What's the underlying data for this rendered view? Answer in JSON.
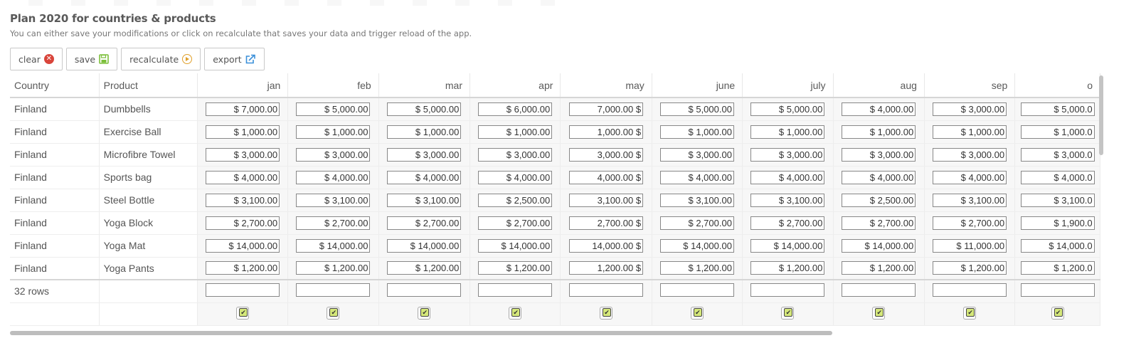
{
  "header": {
    "title": "Plan 2020 for countries & products",
    "subtitle": "You can either save your modifications or click on recalculate that saves your data and trigger reload of the app."
  },
  "toolbar": {
    "clear_label": "clear",
    "save_label": "save",
    "recalculate_label": "recalculate",
    "export_label": "export"
  },
  "table": {
    "columns": [
      "Country",
      "Product",
      "jan",
      "feb",
      "mar",
      "apr",
      "may",
      "june",
      "july",
      "aug",
      "sep",
      "o"
    ],
    "rows": [
      {
        "country": "Finland",
        "product": "Dumbbells",
        "values": [
          "$ 7,000.00",
          "$ 5,000.00",
          "$ 5,000.00",
          "$ 6,000.00",
          "7,000.00 $",
          "$ 5,000.00",
          "$ 5,000.00",
          "$ 4,000.00",
          "$ 3,000.00",
          "$ 5,000.0"
        ]
      },
      {
        "country": "Finland",
        "product": "Exercise Ball",
        "values": [
          "$ 1,000.00",
          "$ 1,000.00",
          "$ 1,000.00",
          "$ 1,000.00",
          "1,000.00 $",
          "$ 1,000.00",
          "$ 1,000.00",
          "$ 1,000.00",
          "$ 1,000.00",
          "$ 1,000.0"
        ]
      },
      {
        "country": "Finland",
        "product": "Microfibre Towel",
        "values": [
          "$ 3,000.00",
          "$ 3,000.00",
          "$ 3,000.00",
          "$ 3,000.00",
          "3,000.00 $",
          "$ 3,000.00",
          "$ 3,000.00",
          "$ 3,000.00",
          "$ 3,000.00",
          "$ 3,000.0"
        ]
      },
      {
        "country": "Finland",
        "product": "Sports bag",
        "values": [
          "$ 4,000.00",
          "$ 4,000.00",
          "$ 4,000.00",
          "$ 4,000.00",
          "4,000.00 $",
          "$ 4,000.00",
          "$ 4,000.00",
          "$ 4,000.00",
          "$ 4,000.00",
          "$ 4,000.0"
        ]
      },
      {
        "country": "Finland",
        "product": "Steel Bottle",
        "values": [
          "$ 3,100.00",
          "$ 3,100.00",
          "$ 3,100.00",
          "$ 2,500.00",
          "3,100.00 $",
          "$ 3,100.00",
          "$ 3,100.00",
          "$ 2,500.00",
          "$ 3,100.00",
          "$ 3,100.0"
        ]
      },
      {
        "country": "Finland",
        "product": "Yoga Block",
        "values": [
          "$ 2,700.00",
          "$ 2,700.00",
          "$ 2,700.00",
          "$ 2,700.00",
          "2,700.00 $",
          "$ 2,700.00",
          "$ 2,700.00",
          "$ 2,700.00",
          "$ 2,700.00",
          "$ 1,900.0"
        ]
      },
      {
        "country": "Finland",
        "product": "Yoga Mat",
        "values": [
          "$ 14,000.00",
          "$ 14,000.00",
          "$ 14,000.00",
          "$ 14,000.00",
          "14,000.00 $",
          "$ 14,000.00",
          "$ 14,000.00",
          "$ 14,000.00",
          "$ 11,000.00",
          "$ 14,000.0"
        ]
      },
      {
        "country": "Finland",
        "product": "Yoga Pants",
        "values": [
          "$ 1,200.00",
          "$ 1,200.00",
          "$ 1,200.00",
          "$ 1,200.00",
          "1,200.00 $",
          "$ 1,200.00",
          "$ 1,200.00",
          "$ 1,200.00",
          "$ 1,200.00",
          "$ 1,200.0"
        ]
      }
    ],
    "row_count_label": "32 rows"
  },
  "icons": {
    "clear": "close-circle-icon",
    "save": "floppy-disk-icon",
    "recalculate": "play-circle-icon",
    "export": "export-icon",
    "apply": "checkbox-icon"
  },
  "colors": {
    "clear_icon": "#d9453b",
    "save_icon": "#7cbf3a",
    "recalculate_icon": "#e0a02a",
    "export_icon": "#3a8fd9",
    "checkbox_fill": "#d5e87a"
  }
}
